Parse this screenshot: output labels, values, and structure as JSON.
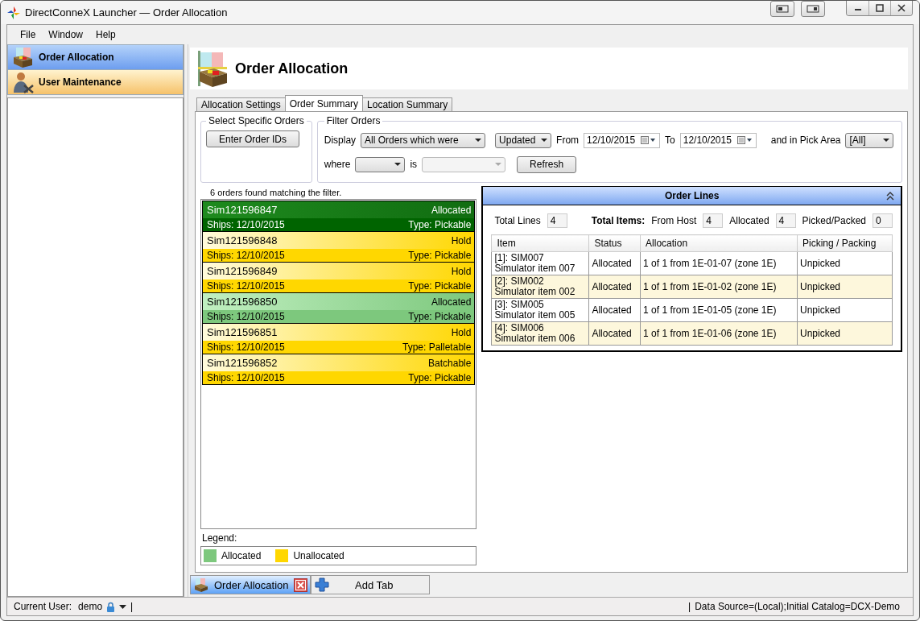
{
  "window": {
    "title": "DirectConneX Launcher — Order Allocation"
  },
  "menu": [
    "File",
    "Window",
    "Help"
  ],
  "sidebar": {
    "items": [
      {
        "label": "Order Allocation",
        "selected": true
      },
      {
        "label": "User Maintenance",
        "selected": false
      }
    ]
  },
  "page": {
    "title": "Order Allocation"
  },
  "tabs": [
    {
      "label": "Allocation Settings",
      "selected": false
    },
    {
      "label": "Order Summary",
      "selected": true
    },
    {
      "label": "Location Summary",
      "selected": false
    }
  ],
  "select_orders": {
    "title": "Select Specific Orders",
    "button": "Enter Order IDs"
  },
  "filter": {
    "title": "Filter Orders",
    "display_label": "Display",
    "display_value": "All Orders which were",
    "event_value": "Updated",
    "from_label": "From",
    "from_date": "12/10/2015",
    "to_label": "To",
    "to_date": "12/10/2015",
    "pick_area_label": "and in Pick Area",
    "pick_area_value": "[All]",
    "where_label": "where",
    "is_label": "is",
    "is_disabled": true,
    "refresh": "Refresh"
  },
  "result_text": "6 orders found matching the filter.",
  "orders": [
    {
      "id": "Sim121596847",
      "status": "Allocated",
      "ships": "Ships: 12/10/2015",
      "type": "Type: Pickable",
      "allocated": true,
      "selected": true
    },
    {
      "id": "Sim121596848",
      "status": "Hold",
      "ships": "Ships: 12/10/2015",
      "type": "Type: Pickable",
      "allocated": false,
      "selected": false
    },
    {
      "id": "Sim121596849",
      "status": "Hold",
      "ships": "Ships: 12/10/2015",
      "type": "Type: Pickable",
      "allocated": false,
      "selected": false
    },
    {
      "id": "Sim121596850",
      "status": "Allocated",
      "ships": "Ships: 12/10/2015",
      "type": "Type: Pickable",
      "allocated": true,
      "selected": false
    },
    {
      "id": "Sim121596851",
      "status": "Hold",
      "ships": "Ships: 12/10/2015",
      "type": "Type: Palletable",
      "allocated": false,
      "selected": false
    },
    {
      "id": "Sim121596852",
      "status": "Batchable",
      "ships": "Ships: 12/10/2015",
      "type": "Type: Pickable",
      "allocated": false,
      "selected": false
    }
  ],
  "legend": {
    "title": "Legend:",
    "items": [
      {
        "label": "Allocated",
        "color": "#7dc87d"
      },
      {
        "label": "Unallocated",
        "color": "#ffd700"
      }
    ]
  },
  "order_lines": {
    "title": "Order Lines",
    "total_lines_label": "Total Lines",
    "total_lines": "4",
    "total_items_label": "Total Items:",
    "from_host_label": "From Host",
    "from_host": "4",
    "allocated_label": "Allocated",
    "allocated": "4",
    "picked_label": "Picked/Packed",
    "picked": "0",
    "columns": [
      "Item",
      "Status",
      "Allocation",
      "Picking / Packing"
    ],
    "rows": [
      {
        "item": "[1]: SIM007",
        "description": "Simulator item 007",
        "status": "Allocated",
        "allocation": "1 of 1 from 1E-01-07 (zone 1E)",
        "picking": "Unpicked"
      },
      {
        "item": "[2]: SIM002",
        "description": "Simulator item 002",
        "status": "Allocated",
        "allocation": "1 of 1 from 1E-01-02 (zone 1E)",
        "picking": "Unpicked"
      },
      {
        "item": "[3]: SIM005",
        "description": "Simulator item 005",
        "status": "Allocated",
        "allocation": "1 of 1 from 1E-01-05 (zone 1E)",
        "picking": "Unpicked"
      },
      {
        "item": "[4]: SIM006",
        "description": "Simulator item 006",
        "status": "Allocated",
        "allocation": "1 of 1 from 1E-01-06 (zone 1E)",
        "picking": "Unpicked"
      }
    ]
  },
  "bottom_tabs": [
    {
      "label": "Order Allocation",
      "kind": "document"
    },
    {
      "label": "Add Tab",
      "kind": "add"
    }
  ],
  "status_bar": {
    "user_label": "Current User:",
    "user": "demo",
    "left_separator": "|",
    "right_separator": "|",
    "data_source": "Data Source=(Local);Initial Catalog=DCX-Demo"
  }
}
